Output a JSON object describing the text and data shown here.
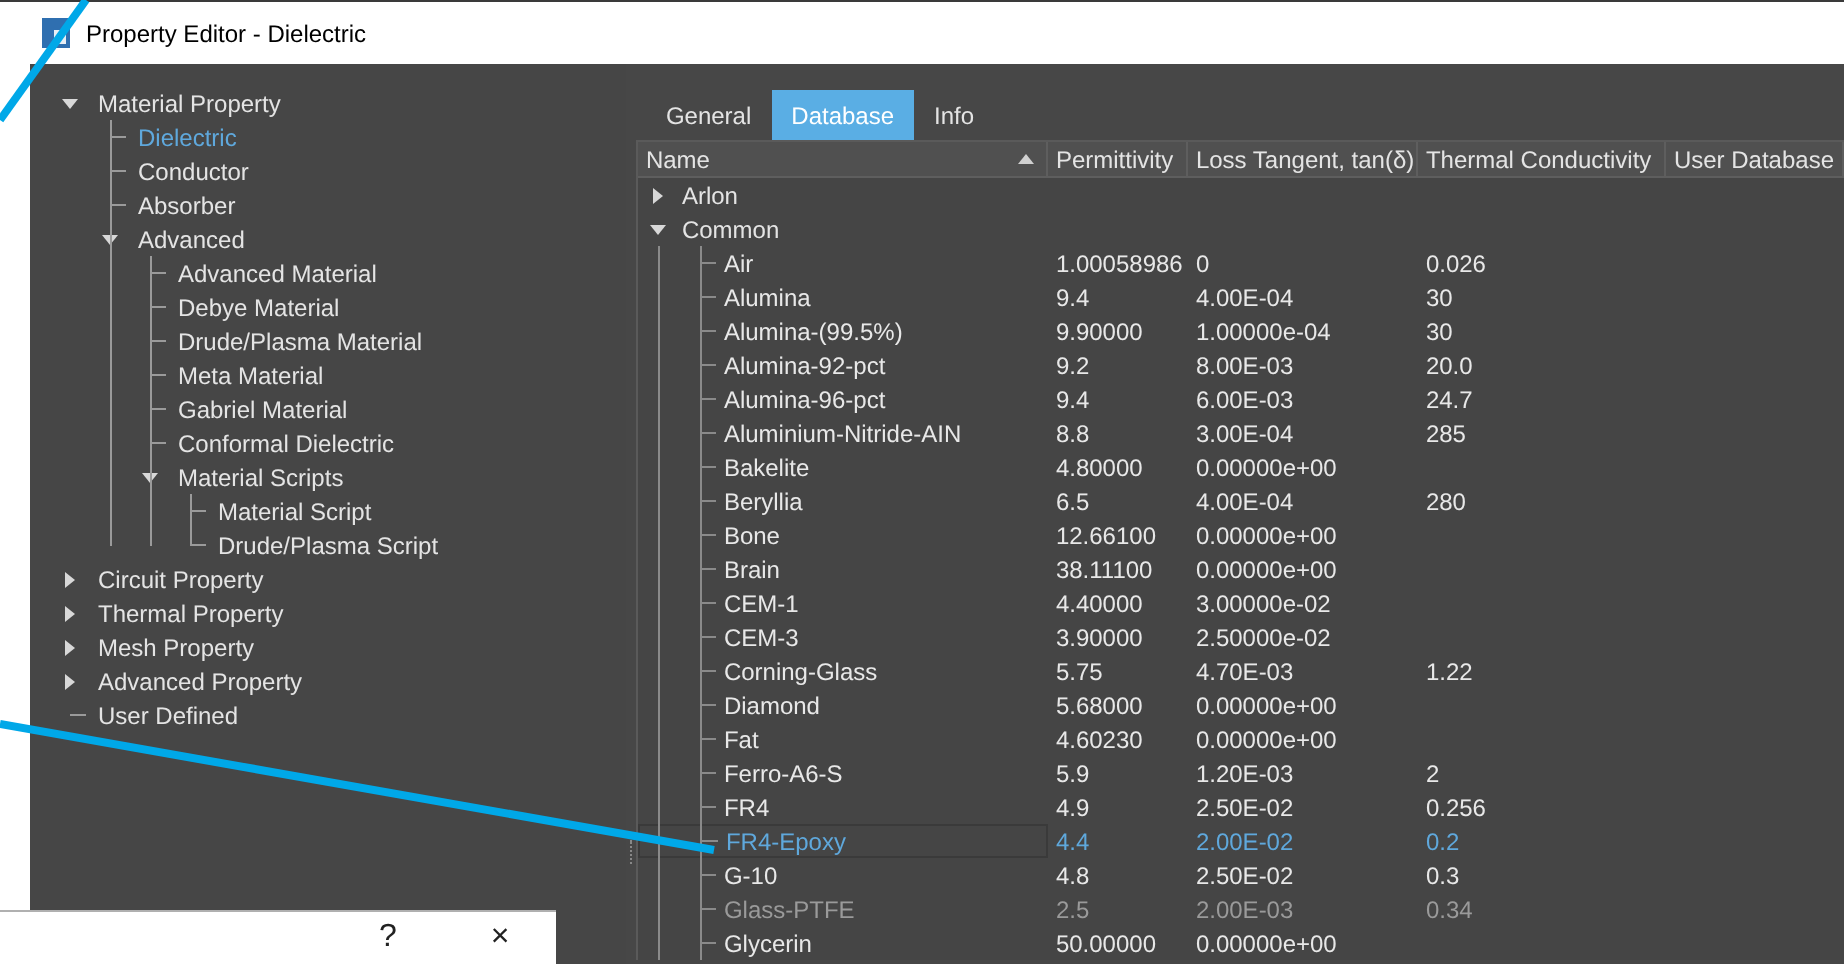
{
  "window": {
    "title": "Property Editor - Dielectric"
  },
  "tree": [
    {
      "label": "Material Property",
      "expanded": true,
      "selected": false,
      "children": [
        {
          "label": "Dielectric",
          "selected": true
        },
        {
          "label": "Conductor",
          "selected": false
        },
        {
          "label": "Absorber",
          "selected": false
        },
        {
          "label": "Advanced",
          "expanded": true,
          "selected": false,
          "children": [
            {
              "label": "Advanced Material",
              "selected": false
            },
            {
              "label": "Debye Material",
              "selected": false
            },
            {
              "label": "Drude/Plasma Material",
              "selected": false
            },
            {
              "label": "Meta Material",
              "selected": false
            },
            {
              "label": "Gabriel Material",
              "selected": false
            },
            {
              "label": "Conformal Dielectric",
              "selected": false
            },
            {
              "label": "Material Scripts",
              "expanded": true,
              "selected": false,
              "children": [
                {
                  "label": "Material Script",
                  "selected": false
                },
                {
                  "label": "Drude/Plasma Script",
                  "selected": false
                }
              ]
            }
          ]
        }
      ]
    },
    {
      "label": "Circuit Property",
      "expanded": false,
      "selected": false
    },
    {
      "label": "Thermal Property",
      "expanded": false,
      "selected": false
    },
    {
      "label": "Mesh Property",
      "expanded": false,
      "selected": false
    },
    {
      "label": "Advanced Property",
      "expanded": false,
      "selected": false
    },
    {
      "label": "User Defined",
      "selected": false
    }
  ],
  "tabs": [
    {
      "label": "General",
      "selected": false
    },
    {
      "label": "Database",
      "selected": true
    },
    {
      "label": "Info",
      "selected": false
    }
  ],
  "table": {
    "columns": [
      "Name",
      "Permittivity",
      "Loss Tangent, tan(δ)",
      "Thermal Conductivity",
      "User Database"
    ],
    "groups": [
      {
        "name": "Arlon",
        "expanded": false
      },
      {
        "name": "Common",
        "expanded": true,
        "rows": [
          {
            "name": "Air",
            "permittivity": "1.00058986",
            "loss_tangent": "0",
            "thermal_conductivity": "0.026",
            "selected": false,
            "disabled": false
          },
          {
            "name": "Alumina",
            "permittivity": "9.4",
            "loss_tangent": "4.00E-04",
            "thermal_conductivity": "30",
            "selected": false,
            "disabled": false
          },
          {
            "name": "Alumina-(99.5%)",
            "permittivity": "9.90000",
            "loss_tangent": "1.00000e-04",
            "thermal_conductivity": "30",
            "selected": false,
            "disabled": false
          },
          {
            "name": "Alumina-92-pct",
            "permittivity": "9.2",
            "loss_tangent": "8.00E-03",
            "thermal_conductivity": "20.0",
            "selected": false,
            "disabled": false
          },
          {
            "name": "Alumina-96-pct",
            "permittivity": "9.4",
            "loss_tangent": "6.00E-03",
            "thermal_conductivity": "24.7",
            "selected": false,
            "disabled": false
          },
          {
            "name": "Aluminium-Nitride-AIN",
            "permittivity": "8.8",
            "loss_tangent": "3.00E-04",
            "thermal_conductivity": "285",
            "selected": false,
            "disabled": false
          },
          {
            "name": "Bakelite",
            "permittivity": "4.80000",
            "loss_tangent": "0.00000e+00",
            "selected": false,
            "disabled": false
          },
          {
            "name": "Beryllia",
            "permittivity": "6.5",
            "loss_tangent": "4.00E-04",
            "thermal_conductivity": "280",
            "selected": false,
            "disabled": false
          },
          {
            "name": "Bone",
            "permittivity": "12.66100",
            "loss_tangent": "0.00000e+00",
            "selected": false,
            "disabled": false
          },
          {
            "name": "Brain",
            "permittivity": "38.11100",
            "loss_tangent": "0.00000e+00",
            "selected": false,
            "disabled": false
          },
          {
            "name": "CEM-1",
            "permittivity": "4.40000",
            "loss_tangent": "3.00000e-02",
            "selected": false,
            "disabled": false
          },
          {
            "name": "CEM-3",
            "permittivity": "3.90000",
            "loss_tangent": "2.50000e-02",
            "selected": false,
            "disabled": false
          },
          {
            "name": "Corning-Glass",
            "permittivity": "5.75",
            "loss_tangent": "4.70E-03",
            "thermal_conductivity": "1.22",
            "selected": false,
            "disabled": false
          },
          {
            "name": "Diamond",
            "permittivity": "5.68000",
            "loss_tangent": "0.00000e+00",
            "selected": false,
            "disabled": false
          },
          {
            "name": "Fat",
            "permittivity": "4.60230",
            "loss_tangent": "0.00000e+00",
            "selected": false,
            "disabled": false
          },
          {
            "name": "Ferro-A6-S",
            "permittivity": "5.9",
            "loss_tangent": "1.20E-03",
            "thermal_conductivity": "2",
            "selected": false,
            "disabled": false
          },
          {
            "name": "FR4",
            "permittivity": "4.9",
            "loss_tangent": "2.50E-02",
            "thermal_conductivity": "0.256",
            "selected": false,
            "disabled": false
          },
          {
            "name": "FR4-Epoxy",
            "permittivity": "4.4",
            "loss_tangent": "2.00E-02",
            "thermal_conductivity": "0.2",
            "selected": true,
            "disabled": false
          },
          {
            "name": "G-10",
            "permittivity": "4.8",
            "loss_tangent": "2.50E-02",
            "thermal_conductivity": "0.3",
            "selected": false,
            "disabled": false
          },
          {
            "name": "Glass-PTFE",
            "permittivity": "2.5",
            "loss_tangent": "2.00E-03",
            "thermal_conductivity": "0.34",
            "selected": false,
            "disabled": true
          },
          {
            "name": "Glycerin",
            "permittivity": "50.00000",
            "loss_tangent": "0.00000e+00",
            "selected": false,
            "disabled": false
          }
        ]
      }
    ]
  },
  "dialog": {
    "buttons": [
      "?",
      "×"
    ]
  }
}
